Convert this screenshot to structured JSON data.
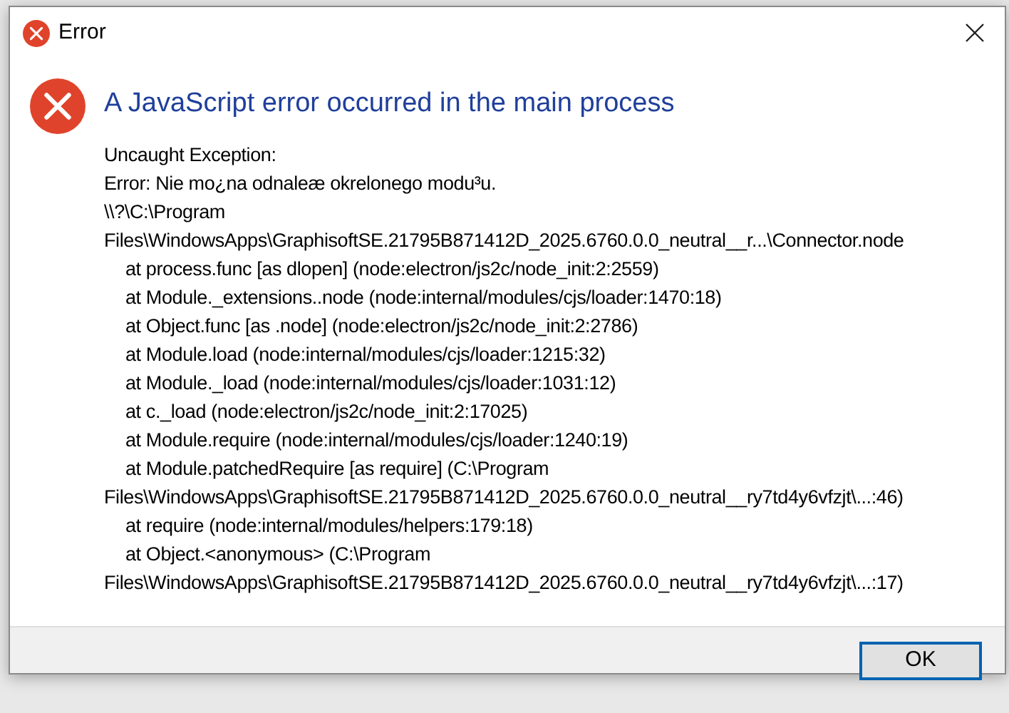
{
  "window": {
    "title": "Error"
  },
  "heading": "A JavaScript error occurred in the main process",
  "message_lines": [
    {
      "text": "Uncaught Exception:",
      "indented": false
    },
    {
      "text": "Error: Nie mo¿na odnaleæ okrelonego modu³u.",
      "indented": false
    },
    {
      "text": "\\\\?\\C:\\Program",
      "indented": false
    },
    {
      "text": "Files\\WindowsApps\\GraphisoftSE.21795B871412D_2025.6760.0.0_neutral__r...\\Connector.node",
      "indented": false
    },
    {
      "text": "at process.func [as dlopen] (node:electron/js2c/node_init:2:2559)",
      "indented": true
    },
    {
      "text": "at Module._extensions..node (node:internal/modules/cjs/loader:1470:18)",
      "indented": true
    },
    {
      "text": "at Object.func [as .node] (node:electron/js2c/node_init:2:2786)",
      "indented": true
    },
    {
      "text": "at Module.load (node:internal/modules/cjs/loader:1215:32)",
      "indented": true
    },
    {
      "text": "at Module._load (node:internal/modules/cjs/loader:1031:12)",
      "indented": true
    },
    {
      "text": "at c._load (node:electron/js2c/node_init:2:17025)",
      "indented": true
    },
    {
      "text": "at Module.require (node:internal/modules/cjs/loader:1240:19)",
      "indented": true
    },
    {
      "text": "at Module.patchedRequire [as require] (C:\\Program",
      "indented": true
    },
    {
      "text": "Files\\WindowsApps\\GraphisoftSE.21795B871412D_2025.6760.0.0_neutral__ry7td4y6vfzjt\\...:46)",
      "indented": false
    },
    {
      "text": "at require (node:internal/modules/helpers:179:18)",
      "indented": true
    },
    {
      "text": "at Object.<anonymous> (C:\\Program",
      "indented": true
    },
    {
      "text": "Files\\WindowsApps\\GraphisoftSE.21795B871412D_2025.6760.0.0_neutral__ry7td4y6vfzjt\\...:17)",
      "indented": false
    }
  ],
  "buttons": [
    {
      "label": "OK",
      "default": true
    }
  ]
}
